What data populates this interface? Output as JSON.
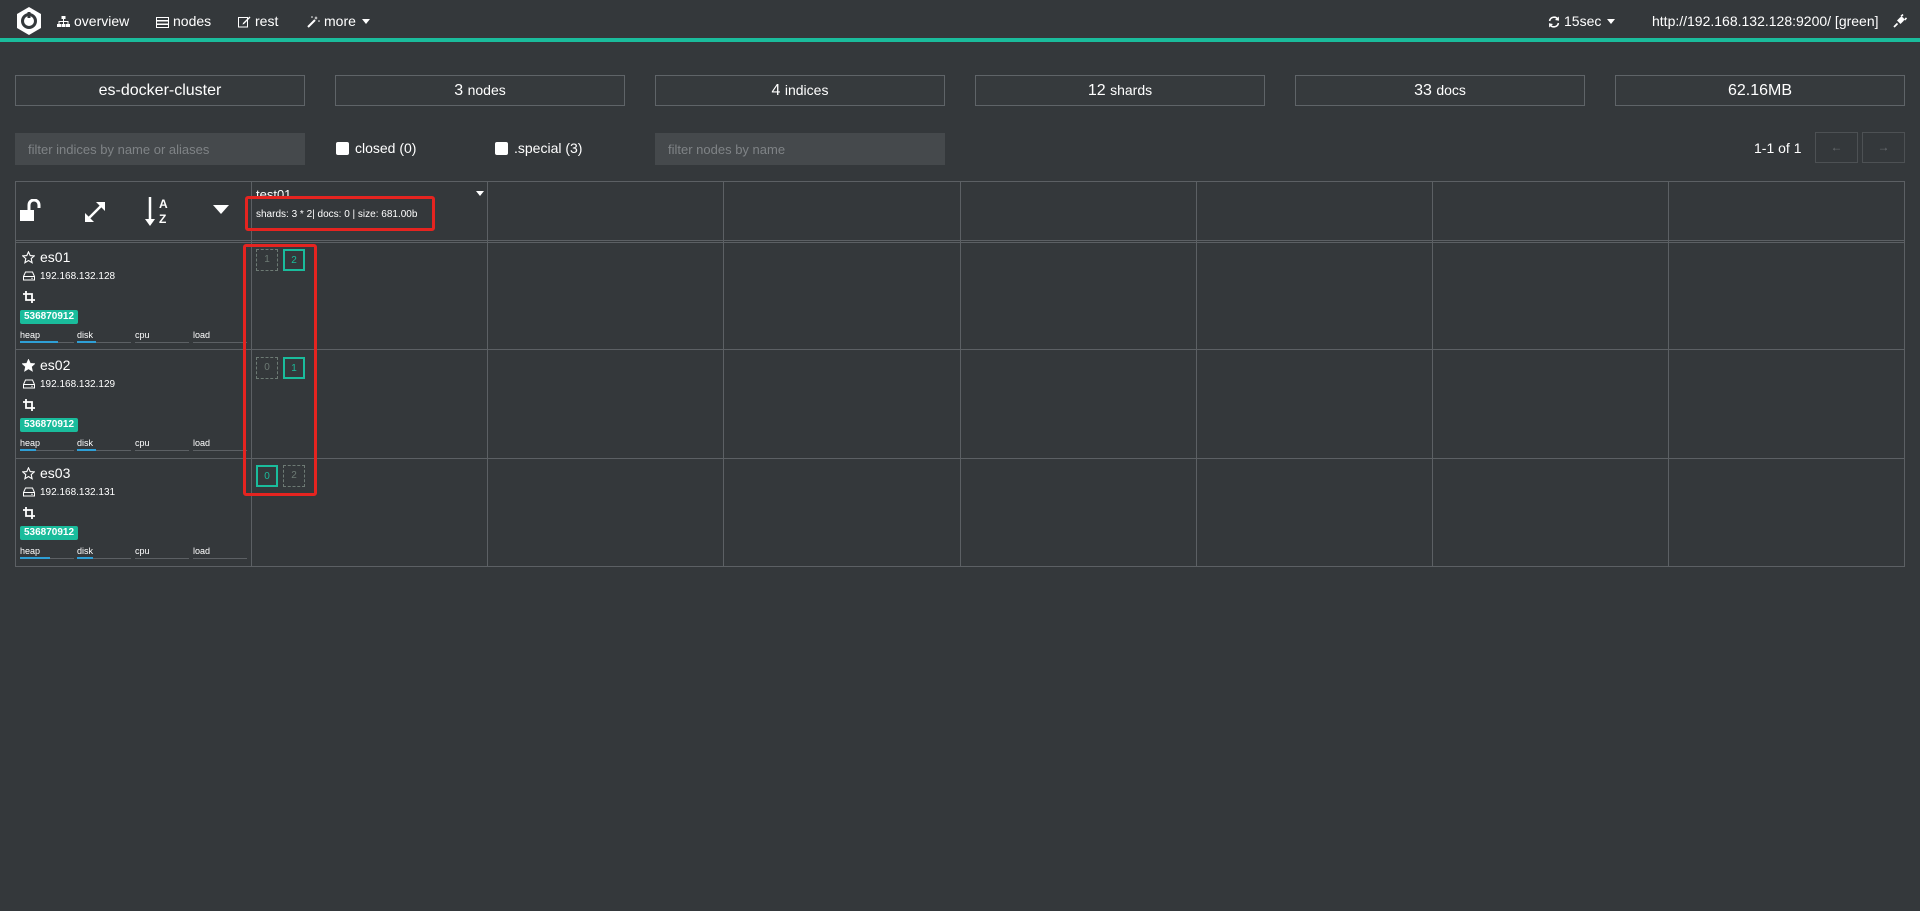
{
  "navbar": {
    "items": [
      {
        "label": "overview",
        "icon": "sitemap-icon"
      },
      {
        "label": "nodes",
        "icon": "server-icon"
      },
      {
        "label": "rest",
        "icon": "edit-icon"
      },
      {
        "label": "more",
        "icon": "magic-wand-icon"
      }
    ],
    "refresh_label": "15sec",
    "host_label": "http://192.168.132.128:9200/ [green]",
    "accent_color": "#1abc9c"
  },
  "stats": {
    "cluster_name": "es-docker-cluster",
    "nodes": {
      "num": "3",
      "label": "nodes"
    },
    "indices": {
      "num": "4",
      "label": "indices"
    },
    "shards": {
      "num": "12",
      "label": "shards"
    },
    "docs": {
      "num": "33",
      "label": "docs"
    },
    "size": "62.16MB"
  },
  "filters": {
    "indices_placeholder": "filter indices by name or aliases",
    "closed_label": "closed (0)",
    "special_label": ".special (3)",
    "nodes_placeholder": "filter nodes by name",
    "pager_text": "1-1 of 1",
    "prev_label": "←",
    "next_label": "→"
  },
  "index": {
    "name": "test01",
    "info": "shards: 3 * 2| docs: 0 | size: 681.00b"
  },
  "nodes": [
    {
      "name": "es01",
      "ip": "192.168.132.128",
      "badge": "536870912",
      "master": false,
      "metrics": {
        "heap": 0.7,
        "disk": 0.35,
        "cpu": 0,
        "load": 0
      },
      "shards": [
        {
          "id": "1",
          "primary": false
        },
        {
          "id": "2",
          "primary": true
        }
      ]
    },
    {
      "name": "es02",
      "ip": "192.168.132.129",
      "badge": "536870912",
      "master": true,
      "metrics": {
        "heap": 0.3,
        "disk": 0.35,
        "cpu": 0,
        "load": 0
      },
      "shards": [
        {
          "id": "0",
          "primary": false
        },
        {
          "id": "1",
          "primary": true
        }
      ]
    },
    {
      "name": "es03",
      "ip": "192.168.132.131",
      "badge": "536870912",
      "master": false,
      "metrics": {
        "heap": 0.55,
        "disk": 0.3,
        "cpu": 0,
        "load": 0
      },
      "shards": [
        {
          "id": "0",
          "primary": true
        },
        {
          "id": "2",
          "primary": false
        }
      ]
    }
  ],
  "metric_labels": {
    "heap": "heap",
    "disk": "disk",
    "cpu": "cpu",
    "load": "load"
  }
}
